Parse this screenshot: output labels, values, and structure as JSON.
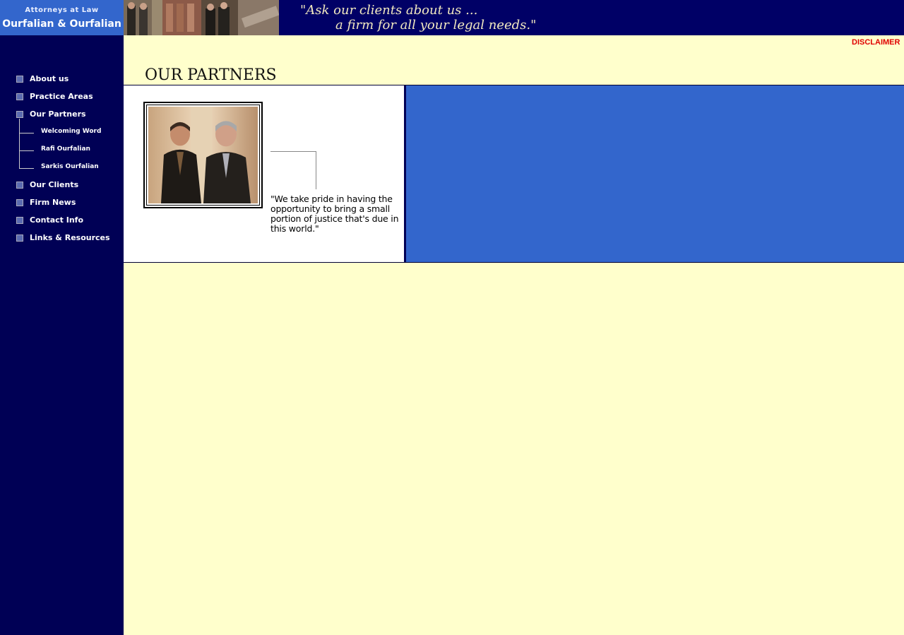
{
  "header": {
    "logo_subtitle": "Attorneys at Law",
    "logo_name": "Ourfalian & Ourfalian",
    "slogan_line1": "\"Ask our clients about us ...",
    "slogan_line2": "a firm for all your legal needs.\"",
    "photo_strip_icon": "office-photo-collage"
  },
  "sidebar": {
    "items": [
      {
        "label": "About us"
      },
      {
        "label": "Practice Areas"
      },
      {
        "label": "Our Partners"
      },
      {
        "label": "Our Clients"
      },
      {
        "label": "Firm News"
      },
      {
        "label": "Contact Info"
      },
      {
        "label": "Links & Resources"
      }
    ],
    "subitems": [
      {
        "label": "Welcoming Word"
      },
      {
        "label": "Rafi Ourfalian"
      },
      {
        "label": "Sarkis Ourfalian"
      }
    ]
  },
  "main": {
    "disclaimer": "DISCLAIMER",
    "page_title": "OUR PARTNERS",
    "quote": "\"We take pride in having the opportunity to bring a small portion of justice that's due in this world.\"",
    "photo_icon": "partners-photo"
  },
  "colors": {
    "header_bg": "#000066",
    "logo_bg": "#3366cc",
    "sidebar_bg": "#000055",
    "page_bg": "#ffffcc",
    "accent_panel": "#3366cc",
    "disclaimer": "#e00000"
  }
}
